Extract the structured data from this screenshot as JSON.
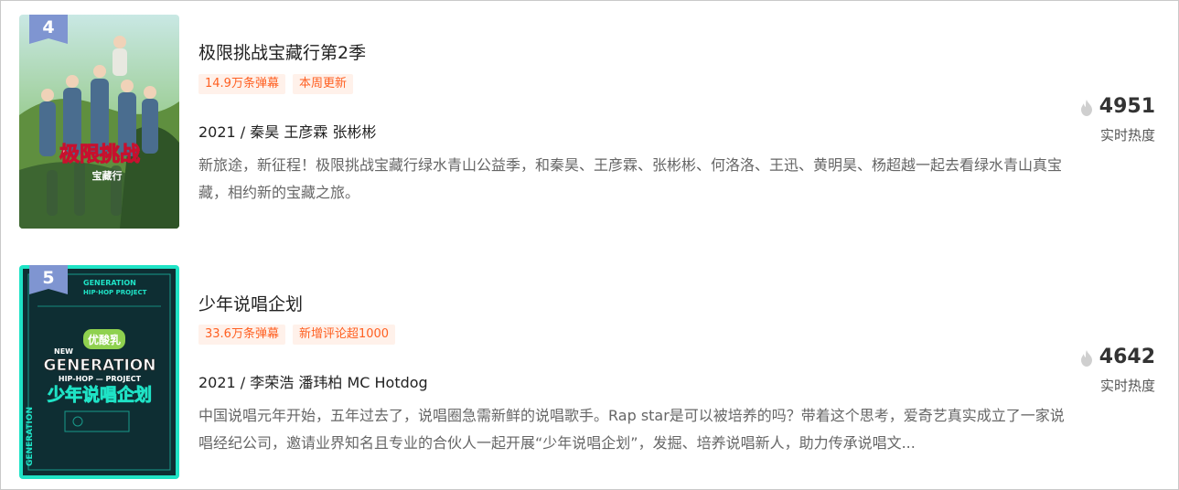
{
  "items": [
    {
      "rank": "4",
      "title": "极限挑战宝藏行第2季",
      "tags": [
        "14.9万条弹幕",
        "本周更新"
      ],
      "meta": "2021 / 秦昊 王彦霖 张彬彬",
      "description": "新旅途，新征程！极限挑战宝藏行绿水青山公益季，和秦昊、王彦霖、张彬彬、何洛洛、王迅、黄明昊、杨超越一起去看绿水青山真宝藏，相约新的宝藏之旅。",
      "heat": "4951",
      "heat_label": "实时热度",
      "poster_text": [
        "极限挑战",
        "宝藏行"
      ],
      "flame_icon": "flame-icon"
    },
    {
      "rank": "5",
      "title": "少年说唱企划",
      "tags": [
        "33.6万条弹幕",
        "新增评论超1000"
      ],
      "meta": "2021 / 李荣浩 潘玮柏 MC Hotdog",
      "description": "中国说唱元年开始，五年过去了，说唱圈急需新鲜的说唱歌手。Rap star是可以被培养的吗？带着这个思考，爱奇艺真实成立了一家说唱经纪公司，邀请业界知名且专业的合伙人一起开展“少年说唱企划”，发掘、培养说唱新人，助力传承说唱文...",
      "heat": "4642",
      "heat_label": "实时热度",
      "poster_text": [
        "GENERATION",
        "HIP·HOP PROJECT",
        "NEW",
        "优酸乳",
        "GENERATION",
        "HIP-HOP — PROJECT",
        "少年说唱企划",
        "GENERATION"
      ],
      "flame_icon": "flame-icon"
    }
  ],
  "colors": {
    "tag_text": "#ff6022",
    "tag_bg": "#fff1ea",
    "rank_badge": "#7f95d1",
    "poster2_accent": "#1fe3c6"
  }
}
